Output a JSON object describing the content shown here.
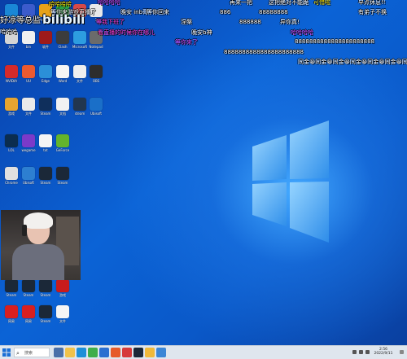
{
  "desktop": {
    "icons": [
      {
        "label": "e1 Edge",
        "color": "#1a87d6",
        "icon": "edge-icon"
      },
      {
        "label": "Microsoft",
        "color": "#3b5bcc",
        "icon": "app-icon"
      },
      {
        "label": "Program",
        "color": "#e6a219",
        "icon": "folder-icon"
      },
      {
        "label": "QQ音乐",
        "color": "#2c9f46",
        "icon": "music-icon"
      },
      {
        "label": "软件",
        "color": "#d64949",
        "icon": "app-icon"
      },
      {
        "label": "1",
        "color": "#e9e9e9",
        "icon": "file-icon"
      },
      {
        "label": "文件",
        "color": "#d5d5d5",
        "icon": "file-icon"
      },
      {
        "label": "bin",
        "color": "#f0f0f0",
        "icon": "file-icon"
      },
      {
        "label": "软件",
        "color": "#9d1a1a",
        "icon": "app-icon"
      },
      {
        "label": "Clash",
        "color": "#3c3c3c",
        "icon": "app-icon"
      },
      {
        "label": "Microsoft",
        "color": "#2d9de0",
        "icon": "app-icon"
      },
      {
        "label": "Notepad",
        "color": "#6b6b6b",
        "icon": "app-icon"
      },
      {
        "label": "NVIDIA",
        "color": "#d62a2a",
        "icon": "app-icon"
      },
      {
        "label": "UU",
        "color": "#ec5a30",
        "icon": "app-icon"
      },
      {
        "label": "Edge",
        "color": "#2b8fd8",
        "icon": "edge-icon"
      },
      {
        "label": "Word",
        "color": "#f5f5f5",
        "icon": "file-icon"
      },
      {
        "label": "文件",
        "color": "#efefef",
        "icon": "file-icon"
      },
      {
        "label": "OBS",
        "color": "#2d2d2d",
        "icon": "obs-icon"
      },
      {
        "label": "游戏",
        "color": "#e6a430",
        "icon": "game-icon"
      },
      {
        "label": "文件",
        "color": "#eaeaea",
        "icon": "file-icon"
      },
      {
        "label": "Steam",
        "color": "#0f2f5c",
        "icon": "steam-icon"
      },
      {
        "label": "文档",
        "color": "#f2f2f2",
        "icon": "file-icon"
      },
      {
        "label": "steam",
        "color": "#22364f",
        "icon": "steam-icon"
      },
      {
        "label": "Ubisoft",
        "color": "#1a6fc8",
        "icon": "ubisoft-icon"
      },
      {
        "label": "LOL",
        "color": "#0b2d4f",
        "icon": "game-icon"
      },
      {
        "label": "wegame",
        "color": "#7b3ac9",
        "icon": "game-icon"
      },
      {
        "label": "txt",
        "color": "#f5f5f5",
        "icon": "file-icon"
      },
      {
        "label": "GeForce",
        "color": "#64b42c",
        "icon": "nvidia-icon"
      },
      {
        "label": "Chrome",
        "color": "#e0e0e0",
        "icon": "chrome-icon"
      },
      {
        "label": "Ubisoft",
        "color": "#2d7fd1",
        "icon": "ubisoft-icon"
      },
      {
        "label": "Steam",
        "color": "#1b2838",
        "icon": "steam-icon"
      },
      {
        "label": "Steam",
        "color": "#1b2838",
        "icon": "steam-icon"
      },
      {
        "label": "Steam",
        "color": "#1b2838",
        "icon": "steam-icon"
      },
      {
        "label": "Steam",
        "color": "#1b2838",
        "icon": "steam-icon"
      },
      {
        "label": "Steam",
        "color": "#1b2838",
        "icon": "steam-icon"
      },
      {
        "label": "游戏",
        "color": "#c91b1b",
        "icon": "game-icon"
      },
      {
        "label": "网易",
        "color": "#d81f1f",
        "icon": "app-icon"
      },
      {
        "label": "网易",
        "color": "#d81f1f",
        "icon": "app-icon"
      },
      {
        "label": "Steam",
        "color": "#1b2838",
        "icon": "steam-icon"
      },
      {
        "label": "文件",
        "color": "#f5f5f5",
        "icon": "file-icon"
      }
    ]
  },
  "danmaku": [
    {
      "text": "哈哈哈哈",
      "style": "purple"
    },
    {
      "text": "哈哈哈哈",
      "style": "yellow"
    },
    {
      "text": "再来一把",
      "style": "white"
    },
    {
      "text": "这把绝对不能跪",
      "style": "white"
    },
    {
      "text": "可惜啦",
      "style": "yellow"
    },
    {
      "text": "早点休息!!",
      "style": "white"
    },
    {
      "text": "等你来游戏直播了",
      "style": "white"
    },
    {
      "text": "晚安 inb哥",
      "style": "white"
    },
    {
      "text": "等你回来",
      "style": "white"
    },
    {
      "text": "886",
      "style": "white"
    },
    {
      "text": "88888888",
      "style": "white"
    },
    {
      "text": "有弟子不换",
      "style": "white"
    },
    {
      "text": "等我下班了",
      "style": "pink"
    },
    {
      "text": "涅槃",
      "style": "white"
    },
    {
      "text": "888888",
      "style": "white"
    },
    {
      "text": "异你真!",
      "style": "white"
    },
    {
      "text": "看直播的时候你在哪儿",
      "style": "pink"
    },
    {
      "text": "晚安b神",
      "style": "white"
    },
    {
      "text": "哈哈哈哈",
      "style": "purple"
    },
    {
      "text": "8888888888888888888888",
      "style": "white"
    },
    {
      "text": "等你来了",
      "style": "purple"
    },
    {
      "text": "8888888888888888888888",
      "style": "white"
    },
    {
      "text": "同金😀同金😀同金😀同金😀同金😀同金😀同金",
      "style": "white"
    },
    {
      "text": "好凉等总监",
      "style": "big"
    },
    {
      "text": "bilibili",
      "style": "bili"
    },
    {
      "text": "哈哈哈",
      "style": "white"
    }
  ],
  "taskbar": {
    "search_placeholder": "搜索",
    "apps": [
      {
        "icon": "task-view-icon",
        "color": "#4a6fa8"
      },
      {
        "icon": "file-explorer-icon",
        "color": "#f1c24a"
      },
      {
        "icon": "edge-icon",
        "color": "#1d8fd8"
      },
      {
        "icon": "chrome-icon",
        "color": "#3fae4a"
      },
      {
        "icon": "store-icon",
        "color": "#2b6fd0"
      },
      {
        "icon": "app-icon",
        "color": "#e65a2a"
      },
      {
        "icon": "app-icon",
        "color": "#d63a3a"
      },
      {
        "icon": "steam-icon",
        "color": "#1b2838"
      },
      {
        "icon": "app-icon",
        "color": "#f0b93a"
      },
      {
        "icon": "app-icon",
        "color": "#3b86d6"
      }
    ],
    "time": "2:56",
    "date": "2022/9/11"
  }
}
